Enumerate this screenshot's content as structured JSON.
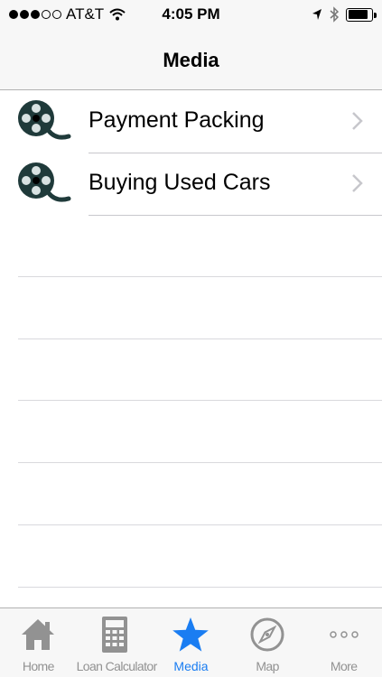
{
  "status_bar": {
    "carrier": "AT&T",
    "time": "4:05 PM",
    "signal_bars_filled": 3,
    "signal_bars_total": 5,
    "battery_level": 0.85
  },
  "nav": {
    "title": "Media"
  },
  "media_items": [
    {
      "label": "Payment Packing",
      "icon": "film-reel-icon"
    },
    {
      "label": "Buying Used Cars",
      "icon": "film-reel-icon"
    }
  ],
  "tabs": [
    {
      "label": "Home",
      "icon": "home-icon",
      "active": false
    },
    {
      "label": "Loan Calculator",
      "icon": "calculator-icon",
      "active": false
    },
    {
      "label": "Media",
      "icon": "star-icon",
      "active": true
    },
    {
      "label": "Map",
      "icon": "compass-icon",
      "active": false
    },
    {
      "label": "More",
      "icon": "more-dots-icon",
      "active": false
    }
  ],
  "colors": {
    "accent": "#1a7df2",
    "inactive_tab": "#929292",
    "film_icon": "#1f3a3a",
    "separator": "#c8c7cc"
  }
}
